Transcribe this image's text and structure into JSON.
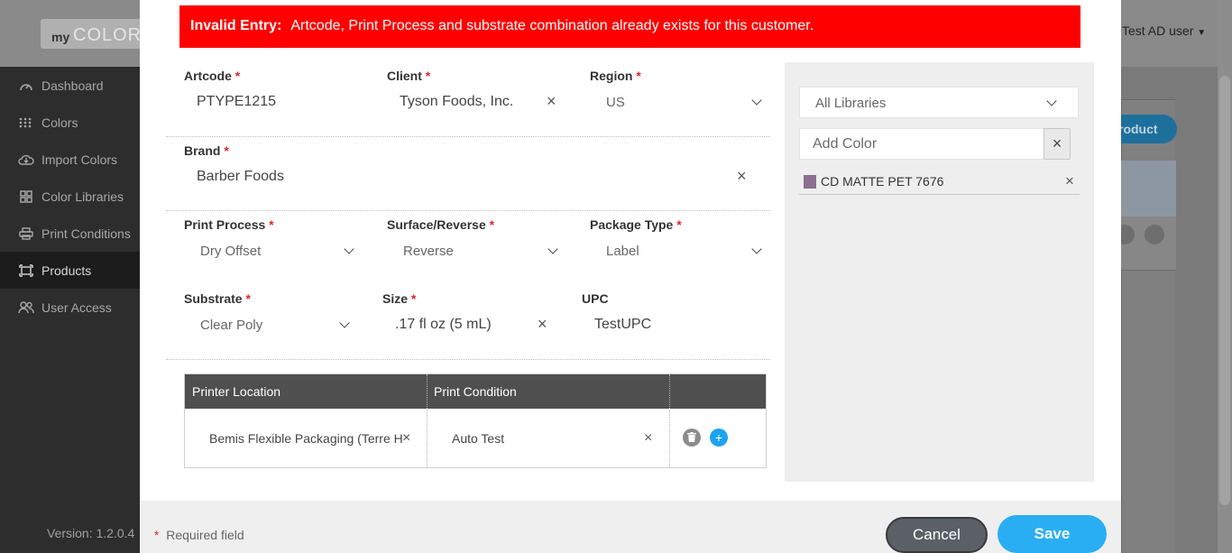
{
  "app": {
    "logo_my": "my",
    "logo_colors": "COLORS",
    "user_menu": "Test AD user",
    "version": "Version: 1.2.0.4",
    "bg_product_btn": "roduct",
    "sidebar": [
      {
        "label": "Dashboard",
        "icon": "dashboard-icon"
      },
      {
        "label": "Colors",
        "icon": "colors-icon"
      },
      {
        "label": "Import Colors",
        "icon": "import-icon"
      },
      {
        "label": "Color Libraries",
        "icon": "libraries-icon"
      },
      {
        "label": "Print Conditions",
        "icon": "printer-icon"
      },
      {
        "label": "Products",
        "icon": "products-icon",
        "active": true
      },
      {
        "label": "User Access",
        "icon": "users-icon"
      }
    ]
  },
  "modal": {
    "alert": {
      "title": "Invalid Entry:",
      "message": "Artcode, Print Process and substrate combination already exists for this customer."
    },
    "fields": {
      "artcode": {
        "label": "Artcode",
        "value": "PTYPE1215"
      },
      "client": {
        "label": "Client",
        "value": "Tyson Foods, Inc."
      },
      "region": {
        "label": "Region",
        "value": "US"
      },
      "brand": {
        "label": "Brand",
        "value": "Barber Foods"
      },
      "print_process": {
        "label": "Print Process",
        "value": "Dry Offset"
      },
      "surface_reverse": {
        "label": "Surface/Reverse",
        "value": "Reverse"
      },
      "package_type": {
        "label": "Package Type",
        "value": "Label"
      },
      "substrate": {
        "label": "Substrate",
        "value": "Clear Poly"
      },
      "size": {
        "label": "Size",
        "value": ".17 fl oz (5 mL)"
      },
      "upc": {
        "label": "UPC",
        "value": "TestUPC"
      }
    },
    "required_marker": "*",
    "printer_table": {
      "headers": [
        "Printer Location",
        "Print Condition",
        ""
      ],
      "rows": [
        {
          "printer_location": "Bemis Flexible Packaging (Terre H",
          "print_condition": "Auto Test"
        }
      ]
    },
    "right_panel": {
      "library_select": "All Libraries",
      "add_color_placeholder": "Add Color",
      "colors": [
        {
          "name": "CD MATTE PET 7676",
          "swatch": "#8a6f8e"
        }
      ]
    },
    "footer": {
      "required_note": "Required field",
      "cancel": "Cancel",
      "save": "Save"
    }
  }
}
